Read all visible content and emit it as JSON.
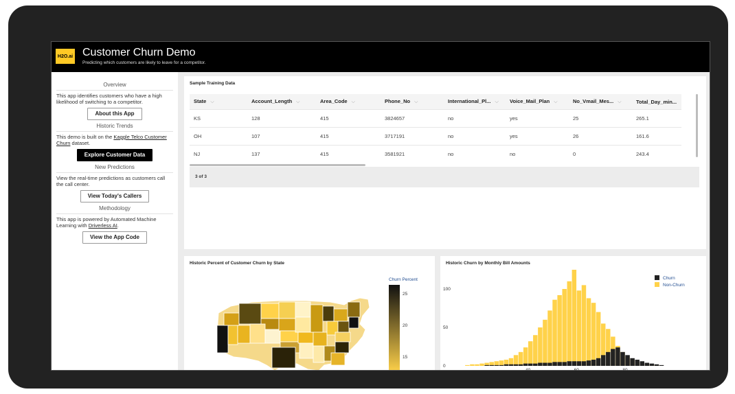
{
  "header": {
    "logo": "H2O.ai",
    "title": "Customer Churn Demo",
    "subtitle": "Predicting which customers are likely to leave for a competitor."
  },
  "sidebar": {
    "overview": {
      "heading": "Overview",
      "text": "This app identifies customers who have a high likelihood of switching to a competitor.",
      "button": "About this App"
    },
    "historic": {
      "heading": "Historic Trends",
      "text_before": "This demo is built on the ",
      "link": "Kaggle Telco Customer Churn",
      "text_after": " dataset.",
      "button": "Explore Customer Data"
    },
    "predictions": {
      "heading": "New Predictions",
      "text": "View the real-time predictions as customers call the call center.",
      "button": "View Today's Callers"
    },
    "methodology": {
      "heading": "Methodology",
      "text_before": "This app is powered by Automated Machine Learning with ",
      "link": "Driverless AI",
      "text_after": ".",
      "button": "View the App Code"
    }
  },
  "table_card": {
    "title": "Sample Training Data",
    "columns": [
      "State",
      "Account_Length",
      "Area_Code",
      "Phone_No",
      "International_Pl...",
      "Voice_Mail_Plan",
      "No_Vmail_Mes...",
      "Total_Day_min..."
    ],
    "rows": [
      [
        "KS",
        "128",
        "415",
        "3824657",
        "no",
        "yes",
        "25",
        "265.1"
      ],
      [
        "OH",
        "107",
        "415",
        "3717191",
        "no",
        "yes",
        "26",
        "161.6"
      ],
      [
        "NJ",
        "137",
        "415",
        "3581921",
        "no",
        "no",
        "0",
        "243.4"
      ]
    ],
    "pagination": "3 of 3"
  },
  "map_card": {
    "title": "Historic Percent of Customer Churn by State",
    "legend_title": "Churn Percent",
    "legend_ticks": [
      "25",
      "20",
      "15"
    ],
    "colors": {
      "low": "#ffd24a",
      "high": "#111111"
    }
  },
  "chart_data": {
    "type": "bar",
    "title": "Historic Churn by Monthly Bill Amounts",
    "xlabel": "",
    "ylabel": "",
    "x_ticks": [
      "40",
      "60",
      "80"
    ],
    "y_ticks": [
      "100",
      "50",
      "0"
    ],
    "x": [
      14,
      16,
      18,
      20,
      22,
      24,
      26,
      28,
      30,
      32,
      34,
      36,
      38,
      40,
      42,
      44,
      46,
      48,
      50,
      52,
      54,
      56,
      58,
      60,
      62,
      64,
      66,
      68,
      70,
      72,
      74,
      76,
      78,
      80,
      82,
      84,
      86,
      88,
      90,
      92,
      94
    ],
    "series": [
      {
        "name": "Non-Churn",
        "color": "#ffd24a",
        "values": [
          1,
          2,
          2,
          3,
          4,
          5,
          6,
          7,
          8,
          10,
          14,
          18,
          24,
          32,
          40,
          50,
          60,
          72,
          86,
          92,
          100,
          110,
          125,
          98,
          105,
          88,
          82,
          70,
          55,
          48,
          38,
          26,
          18,
          12,
          8,
          5,
          3,
          2,
          1,
          1,
          0
        ]
      },
      {
        "name": "Churn",
        "color": "#222222",
        "values": [
          0,
          0,
          0,
          0,
          1,
          1,
          1,
          1,
          2,
          2,
          2,
          2,
          3,
          3,
          3,
          4,
          4,
          4,
          5,
          5,
          5,
          6,
          6,
          6,
          6,
          7,
          8,
          10,
          14,
          18,
          22,
          24,
          18,
          14,
          10,
          8,
          6,
          4,
          3,
          2,
          1
        ]
      }
    ],
    "ylim": [
      0,
      125
    ],
    "xlim": [
      10,
      100
    ],
    "legend_position": "top-right"
  }
}
